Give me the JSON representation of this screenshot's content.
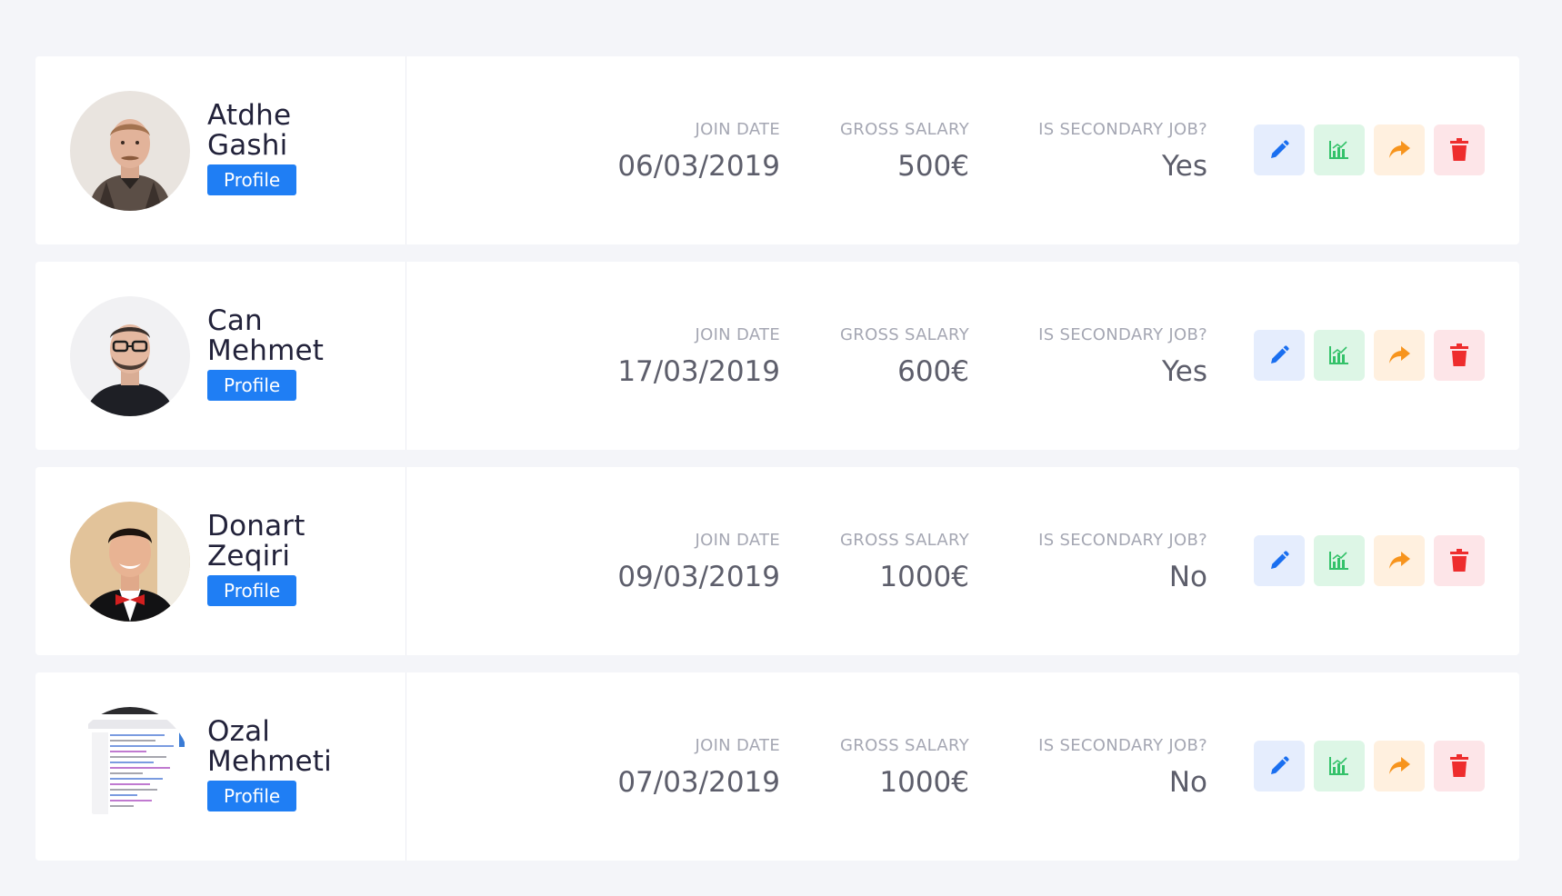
{
  "columns": {
    "join_date": "JOIN DATE",
    "gross_salary": "GROSS SALARY",
    "secondary_job": "IS SECONDARY JOB?"
  },
  "profile_label": "Profile",
  "colors": {
    "primary": "#1f7ef4",
    "edit": "#1a6ff0",
    "stats": "#34c26a",
    "share": "#f7941d",
    "delete": "#ee2d2d"
  },
  "employees": [
    {
      "first": "Atdhe",
      "last": "Gashi",
      "profile": "Profile",
      "join_date": "06/03/2019",
      "gross_salary": "500€",
      "secondary_job": "Yes"
    },
    {
      "first": "Can",
      "last": "Mehmet",
      "profile": "Profile",
      "join_date": "17/03/2019",
      "gross_salary": "600€",
      "secondary_job": "Yes"
    },
    {
      "first": "Donart",
      "last": "Zeqiri",
      "profile": "Profile",
      "join_date": "09/03/2019",
      "gross_salary": "1000€",
      "secondary_job": "No"
    },
    {
      "first": "Ozal",
      "last": "Mehmeti",
      "profile": "Profile",
      "join_date": "07/03/2019",
      "gross_salary": "1000€",
      "secondary_job": "No"
    }
  ]
}
